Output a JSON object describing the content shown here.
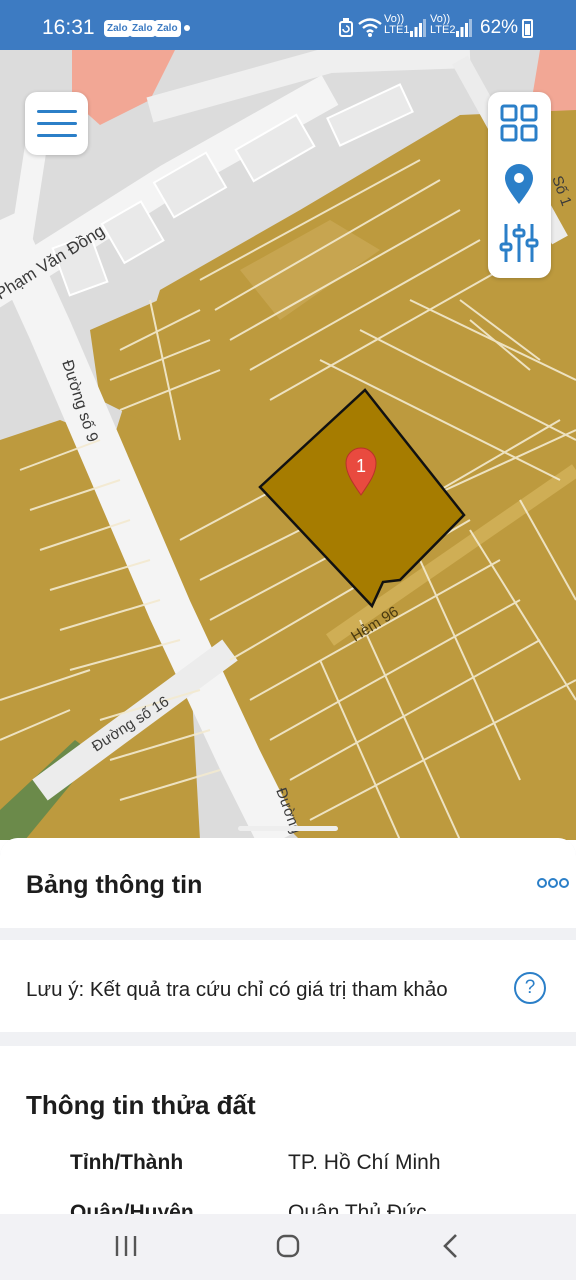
{
  "status_bar": {
    "time": "16:31",
    "notification_apps": [
      "Zalo",
      "Zalo",
      "Zalo"
    ],
    "sim1_label_top": "Vo))",
    "sim1_label_bottom": "LTE1",
    "sim2_label_top": "Vo))",
    "sim2_label_bottom": "LTE2",
    "battery": "62%"
  },
  "map": {
    "street_labels": {
      "pham_van_dong": "Phạm Văn Đồng",
      "duong_so_9": "Đường số 9",
      "duong_so_16": "Đường số 16",
      "hem_96": "Hẻm 96",
      "duong_partial": "Đường",
      "so_1_partial": "Số 1"
    },
    "marker_label": "1",
    "colors": {
      "land": "#bd9a3e",
      "selected_parcel": "#a67c00",
      "marker": "#e94a3f",
      "accent": "#2b7fc8"
    }
  },
  "panel": {
    "title": "Bảng thông tin",
    "note": "Lưu ý: Kết quả tra cứu chỉ có giá trị tham khảo",
    "help_symbol": "?",
    "section_title": "Thông tin thửa đất",
    "rows": [
      {
        "label": "Tỉnh/Thành",
        "value": "TP. Hồ Chí Minh"
      },
      {
        "label": "Quận/Huyện",
        "value": "Quận Thủ Đức"
      }
    ]
  }
}
